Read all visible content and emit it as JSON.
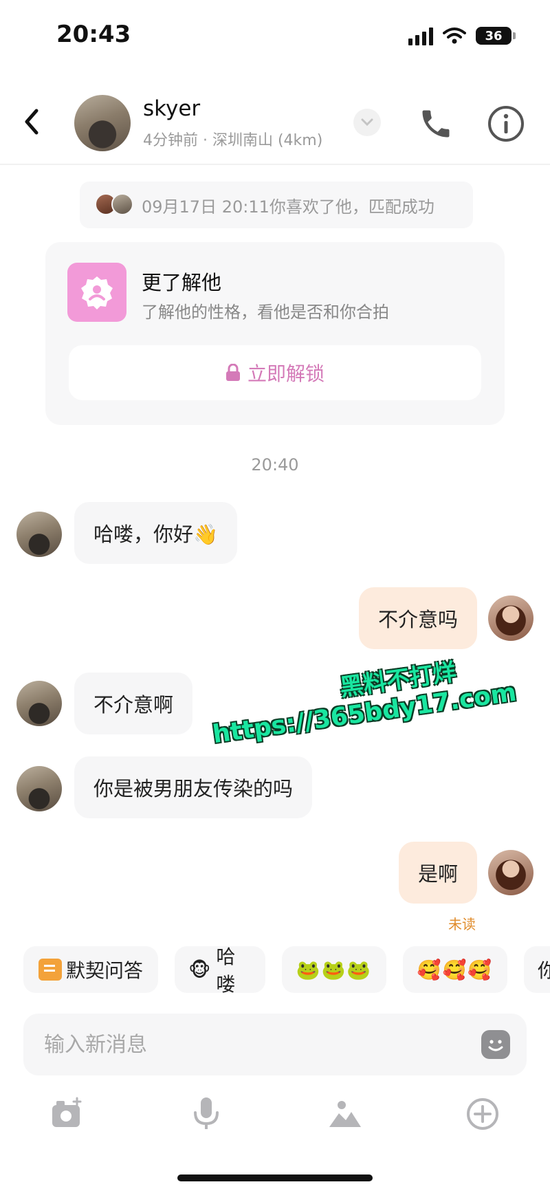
{
  "status_bar": {
    "time": "20:43",
    "battery": "36"
  },
  "header": {
    "name": "skyer",
    "subtitle": "4分钟前 · 深圳南山 (4km)"
  },
  "match_notice": {
    "text": "09月17日 20:11你喜欢了他，匹配成功"
  },
  "know_card": {
    "title": "更了解他",
    "subtitle": "了解他的性格，看他是否和你合拍",
    "unlock_label": "立即解锁"
  },
  "time_divider": "20:40",
  "messages": [
    {
      "side": "in",
      "text": "哈喽，你好👋"
    },
    {
      "side": "out",
      "text": "不介意吗"
    },
    {
      "side": "in",
      "text": "不介意啊"
    },
    {
      "side": "in",
      "text": "你是被男朋友传染的吗"
    },
    {
      "side": "out",
      "text": "是啊"
    }
  ],
  "unread_label": "未读",
  "quick_replies": [
    {
      "label": "默契问答",
      "icon": "note-icon"
    },
    {
      "label": "哈喽",
      "emoji": "🐵"
    },
    {
      "emoji": "🐸🐸🐸"
    },
    {
      "emoji": "🥰🥰🥰"
    },
    {
      "label": "你"
    }
  ],
  "input": {
    "placeholder": "输入新消息"
  },
  "toolbar": [
    "camera-icon",
    "microphone-icon",
    "image-icon",
    "plus-circle-icon"
  ],
  "watermark": {
    "line1": "黑料不打烊",
    "line2": "https://365bdy17.com"
  },
  "colors": {
    "accent_pink": "#f29ad8",
    "unlock_text": "#d47ab8",
    "outgoing_bubble": "#fdebdd",
    "incoming_bubble": "#f6f6f7",
    "unread": "#e08c2c"
  }
}
